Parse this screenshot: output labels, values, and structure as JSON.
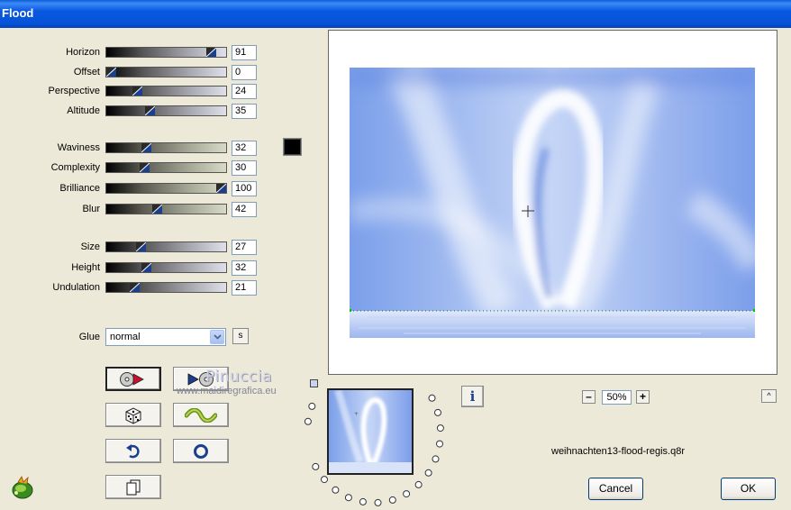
{
  "window": {
    "title": "Flood"
  },
  "sliders": [
    {
      "label": "Horizon",
      "value": "91",
      "level": 0.91,
      "style": "gray"
    },
    {
      "label": "Offset",
      "value": "0",
      "level": 0.0,
      "style": "gray"
    },
    {
      "label": "Perspective",
      "value": "24",
      "level": 0.24,
      "style": "gray"
    },
    {
      "label": "Altitude",
      "value": "35",
      "level": 0.35,
      "style": "gray"
    },
    {
      "label": "Waviness",
      "value": "32",
      "level": 0.32,
      "style": "green"
    },
    {
      "label": "Complexity",
      "value": "30",
      "level": 0.3,
      "style": "green"
    },
    {
      "label": "Brilliance",
      "value": "100",
      "level": 1.0,
      "style": "green"
    },
    {
      "label": "Blur",
      "value": "42",
      "level": 0.42,
      "style": "green"
    },
    {
      "label": "Size",
      "value": "27",
      "level": 0.27,
      "style": "gray"
    },
    {
      "label": "Height",
      "value": "32",
      "level": 0.32,
      "style": "gray"
    },
    {
      "label": "Undulation",
      "value": "21",
      "level": 0.21,
      "style": "gray"
    }
  ],
  "color_swatch": "#000000",
  "glue": {
    "label": "Glue",
    "value": "normal",
    "s_button": "s"
  },
  "watermark": {
    "name": "Pinuccia",
    "url": "www.maidiregrafica.eu"
  },
  "zoom": {
    "minus": "–",
    "value": "50%",
    "plus": "+"
  },
  "info_button": "i",
  "caret_button": "^",
  "filename": "weihnachten13-flood-regis.q8r",
  "buttons": {
    "cancel": "Cancel",
    "ok": "OK"
  },
  "colors": {
    "titlebar": "#0a5fd8",
    "preview_blue": "#6f95e6"
  }
}
